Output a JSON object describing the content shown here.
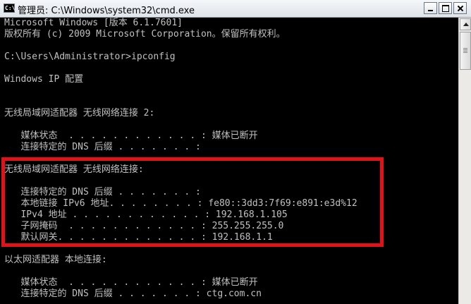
{
  "window": {
    "title": "管理员: C:\\Windows\\system32\\cmd.exe",
    "app_icon_text": "C:\\",
    "controls": [
      "minimize-icon",
      "maximize-icon",
      "close-icon"
    ]
  },
  "console": {
    "lines": [
      "Microsoft Windows [版本 6.1.7601]",
      "版权所有 (c) 2009 Microsoft Corporation。保留所有权利。",
      "",
      "C:\\Users\\Administrator>ipconfig",
      "",
      "Windows IP 配置",
      "",
      "",
      "无线局域网适配器 无线网络连接 2:",
      "",
      "   媒体状态  . . . . . . . . . . . . : 媒体已断开",
      "   连接特定的 DNS 后缀 . . . . . . . :",
      "",
      "无线局域网适配器 无线网络连接:",
      "",
      "   连接特定的 DNS 后缀 . . . . . . . :",
      "   本地链接 IPv6 地址. . . . . . . . : fe80::3dd3:7f69:e891:e3d%12",
      "   IPv4 地址 . . . . . . . . . . . . : 192.168.1.105",
      "   子网掩码  . . . . . . . . . . . . : 255.255.255.0",
      "   默认网关. . . . . . . . . . . . . : 192.168.1.1",
      "",
      "以太网适配器 本地连接:",
      "",
      "   媒体状态  . . . . . . . . . . . . : 媒体已断开",
      "   连接特定的 DNS 后缀 . . . . . . . : ctg.com.cn"
    ]
  },
  "colors": {
    "console_bg": "#000000",
    "console_text": "#c0c0c0",
    "highlight_border": "#e11218"
  }
}
